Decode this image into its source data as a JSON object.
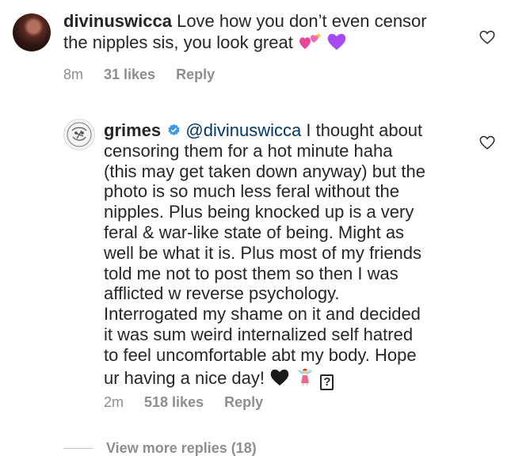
{
  "comments": [
    {
      "username": "divinuswicca",
      "text_line1": "Love how you don’t even censor",
      "text_line2": "the nipples sis, you look great",
      "time": "8m",
      "likes": "31 likes",
      "reply": "Reply"
    },
    {
      "username": "grimes",
      "mention": "@divinuswicca",
      "lines": [
        "I thought about",
        "censoring them for a hot minute haha",
        "(this may get taken down anyway) but the",
        "photo is so much less feral without the",
        "nipples.  Plus being knocked up is a very",
        "feral & war-like state of being.  Might as",
        "well be what it is.  Plus most of my friends",
        "told me not to post them so then I was",
        "afflicted w reverse psychology.",
        "Interrogated my shame on it and decided",
        "it was sum weird internalized self hatred",
        "to feel uncomfortable abt my body.  Hope",
        "ur having a nice day!"
      ],
      "unknown_glyph": "?",
      "time": "2m",
      "likes": "518 likes",
      "reply": "Reply"
    }
  ],
  "view_more": "View more replies (18)",
  "colors": {
    "text": "#262626",
    "meta": "#8e8e8e",
    "mention": "#00376b",
    "verified": "#3897f0"
  },
  "icons": [
    "heart-icon",
    "verified-badge-icon",
    "sparkling-heart-emoji",
    "purple-heart-emoji",
    "black-heart-emoji",
    "fairy-emoji"
  ]
}
